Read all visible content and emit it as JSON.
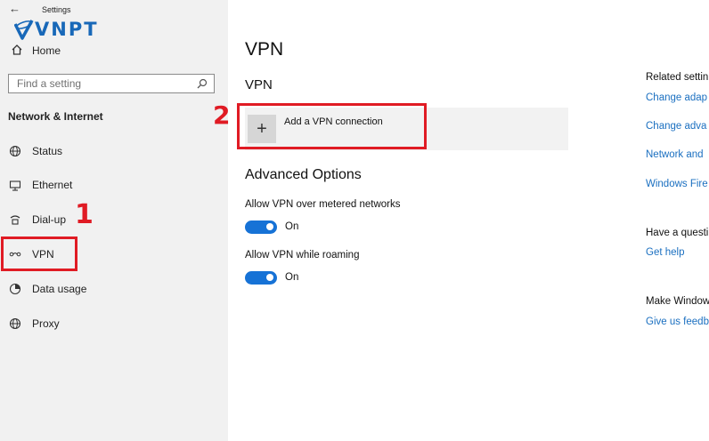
{
  "window": {
    "title": "Settings",
    "brand_logo": "VNPT"
  },
  "sidebar": {
    "home_label": "Home",
    "search": {
      "placeholder": "Find a setting"
    },
    "section_title": "Network & Internet",
    "items": [
      {
        "label": "Status",
        "icon": "globe-icon"
      },
      {
        "label": "Ethernet",
        "icon": "ethernet-icon"
      },
      {
        "label": "Dial-up",
        "icon": "dial-up-icon"
      },
      {
        "label": "VPN",
        "icon": "vpn-icon"
      },
      {
        "label": "Data usage",
        "icon": "data-usage-icon"
      },
      {
        "label": "Proxy",
        "icon": "globe-icon"
      }
    ]
  },
  "annotations": {
    "step1": "1",
    "step2": "2",
    "color": "#e01b24"
  },
  "main": {
    "title": "VPN",
    "subtitle": "VPN",
    "add_vpn_label": "Add a VPN connection",
    "advanced_title": "Advanced Options",
    "options": [
      {
        "label": "Allow VPN over metered networks",
        "state": "On",
        "enabled": true
      },
      {
        "label": "Allow VPN while roaming",
        "state": "On",
        "enabled": true
      }
    ]
  },
  "related": {
    "heading": "Related settin",
    "links": [
      "Change adap",
      "Change adva",
      "Network and",
      "Windows Fire"
    ],
    "question_heading": "Have a questi",
    "help_link": "Get help",
    "feedback_heading": "Make Window",
    "feedback_link": "Give us feedb"
  },
  "colors": {
    "accent": "#1672d6",
    "link": "#1a6fc0",
    "sidebar_bg": "#f1f1f1"
  }
}
